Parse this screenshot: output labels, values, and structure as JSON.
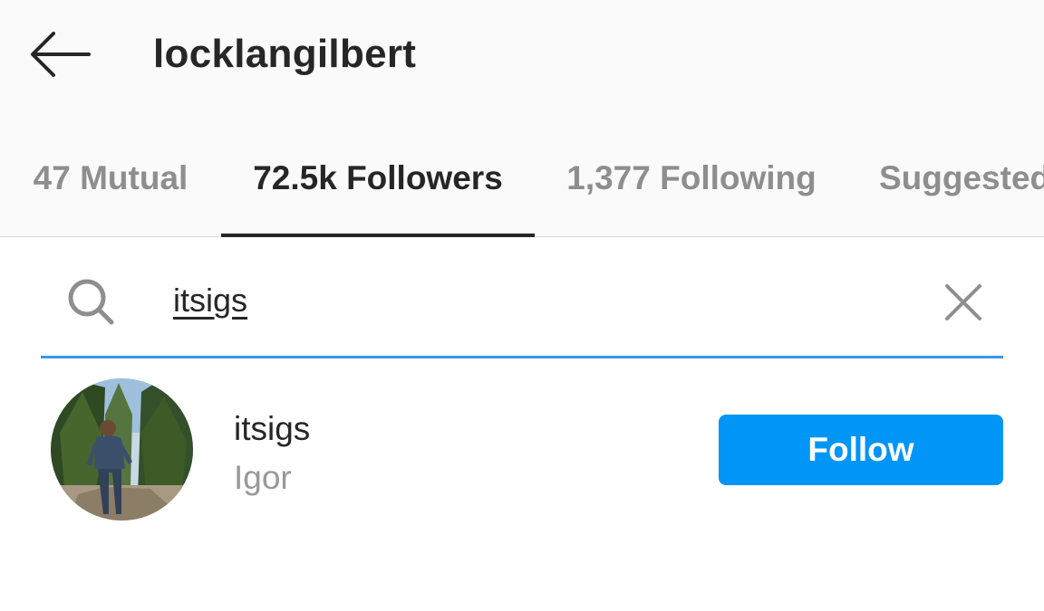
{
  "header": {
    "title": "locklangilbert",
    "back_icon": "arrow-left-icon"
  },
  "tabs": [
    {
      "label": "47 Mutual",
      "active": false
    },
    {
      "label": "72.5k Followers",
      "active": true
    },
    {
      "label": "1,377 Following",
      "active": false
    },
    {
      "label": "Suggested",
      "active": false
    }
  ],
  "search": {
    "value": "itsigs",
    "placeholder": "Search",
    "search_icon": "search-icon",
    "clear_icon": "close-icon",
    "accent_color": "#3897f0"
  },
  "results": [
    {
      "username": "itsigs",
      "full_name": "Igor",
      "follow_label": "Follow",
      "follow_color": "#0095f6"
    }
  ]
}
